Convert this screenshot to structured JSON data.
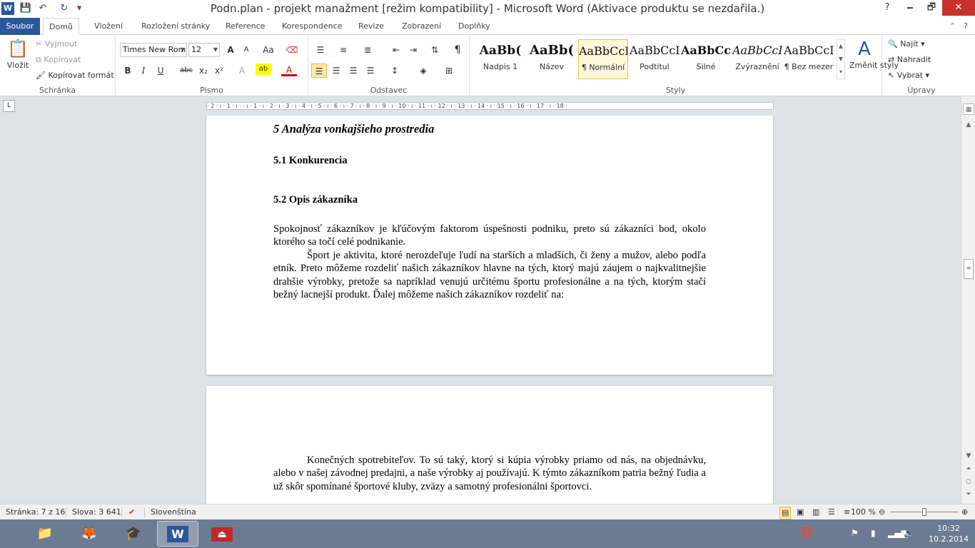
{
  "window": {
    "title": "Podn.plan - projekt manažment [režim kompatibility]  -  Microsoft Word (Aktivace produktu se nezdařila.)",
    "help": "?",
    "minimize": "🗕",
    "maximize": "🗗",
    "close": "✕"
  },
  "quick_access": {
    "app_icon": "W",
    "save": "💾",
    "undo": "↶",
    "redo": "↻",
    "customize": "▾"
  },
  "tabs": [
    "Soubor",
    "Domů",
    "Vložení",
    "Rozložení stránky",
    "Reference",
    "Korespondence",
    "Revize",
    "Zobrazení",
    "Doplňky"
  ],
  "ribbon": {
    "clipboard": {
      "label": "Schránka",
      "paste": "Vložit",
      "cut": "Vyjmout",
      "copy": "Kopírovat",
      "format_painter": "Kopírovat formát"
    },
    "font": {
      "label": "Písmo",
      "font_name": "Times New Rom",
      "font_size": "12",
      "grow": "A",
      "shrink": "A",
      "case": "Aa",
      "bold": "B",
      "italic": "I",
      "underline": "U",
      "strike": "abc",
      "subscript": "x₂",
      "superscript": "x²",
      "effects": "A",
      "highlight": "ab",
      "color": "A"
    },
    "paragraph": {
      "label": "Odstavec",
      "pilcrow": "¶"
    },
    "styles": {
      "label": "Styly",
      "items": [
        {
          "preview": "AaBb(",
          "name": "Nadpis 1"
        },
        {
          "preview": "AaBb(",
          "name": "Název"
        },
        {
          "preview": "AaBbCcI",
          "name": "¶ Normální"
        },
        {
          "preview": "AaBbCcI",
          "name": "Podtitul"
        },
        {
          "preview": "AaBbCcl",
          "name": "Silné"
        },
        {
          "preview": "AaBbCcI",
          "name": "Zvýraznění"
        },
        {
          "preview": "AaBbCcI",
          "name": "¶ Bez mezer"
        }
      ],
      "change_styles": "Změnit styly"
    },
    "editing": {
      "label": "Úpravy",
      "find": "Najít",
      "replace": "Nahradit",
      "select": "Vybrat"
    }
  },
  "ruler": {
    "ticks": "· 2 · ı · 1 · ı ·   · ı · 1 · ı · 2 · ı · 3 · ı · 4 · ı · 5 · ı · 6 · ı · 7 · ı · 8 · ı · 9 · ı · 10 · ı · 11 · ı · 12 · ı · 13 · ı · 14 · ı · 15 · ı · 16 · ı · 17 · ı · 18 ·",
    "tab_selector": "L"
  },
  "document": {
    "heading": "5 Analýza vonkajšieho prostredia",
    "sub1": "5.1 Konkurencia",
    "sub2": "5.2 Opis zákazníka",
    "para1": "Spokojnosť zákazníkov je kľúčovým faktorom úspešnosti podniku, preto sú zákazníci bod, okolo ktorého sa točí celé podnikanie.",
    "para2": "Šport je aktivita, ktoré nerozdeľuje ľudí na starších a mladších, či ženy a mužov, alebo podľa etník. Preto môžeme rozdeliť našich zákazníkov hlavne na tých, ktorý majú záujem o najkvalitnejšie drahšie výrobky, pretože sa napríklad venujú určitému športu profesionálne a na tých, ktorým stačí bežný lacnejší produkt. Ďalej môžeme našich zákazníkov rozdeliť na:",
    "para3": "Konečných spotrebiteľov. To sú taký, ktorý si kúpia výrobky priamo od nás, na objednávku, alebo v našej závodnej predajni, a naše výrobky aj používajú. K týmto zákazníkom patria bežný ľudia a už skôr spomínané športové kluby, zväzy a samotný profesionálni športovci."
  },
  "status": {
    "page": "Stránka: 7 z 16",
    "words": "Slova: 3 641",
    "language": "Slovenština",
    "zoom": "100 %",
    "zoom_level": 0.5
  },
  "taskbar": {
    "apps": [
      {
        "icon": "📁",
        "name": "explorer"
      },
      {
        "icon": "🦊",
        "name": "firefox"
      },
      {
        "icon": "🎓",
        "name": "app3"
      },
      {
        "icon": "W",
        "name": "word"
      },
      {
        "icon": "⏏",
        "name": "acrobat"
      }
    ],
    "time": "10:32",
    "date": "10.2.2014"
  }
}
